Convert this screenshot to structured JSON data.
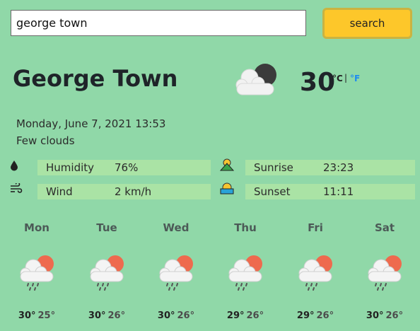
{
  "search": {
    "value": "george town",
    "button_label": "search"
  },
  "current": {
    "city": "George Town",
    "temperature": "30",
    "unit_c": "°C",
    "unit_sep": "|",
    "unit_f": "°F",
    "datetime": "Monday, June 7, 2021 13:53",
    "description": "Few clouds",
    "icon": "cloud-moon-icon"
  },
  "stats": {
    "humidity_label": "Humidity",
    "humidity_value": "76%",
    "wind_label": "Wind",
    "wind_value": "2 km/h",
    "sunrise_label": "Sunrise",
    "sunrise_value": "23:23",
    "sunset_label": "Sunset",
    "sunset_value": "11:11"
  },
  "forecast": [
    {
      "day": "Mon",
      "hi": "30°",
      "lo": "25°",
      "icon": "rain-cloud-sun-icon"
    },
    {
      "day": "Tue",
      "hi": "30°",
      "lo": "26°",
      "icon": "rain-cloud-sun-icon"
    },
    {
      "day": "Wed",
      "hi": "30°",
      "lo": "26°",
      "icon": "rain-cloud-sun-icon"
    },
    {
      "day": "Thu",
      "hi": "29°",
      "lo": "26°",
      "icon": "rain-cloud-sun-icon"
    },
    {
      "day": "Fri",
      "hi": "29°",
      "lo": "26°",
      "icon": "rain-cloud-sun-icon"
    },
    {
      "day": "Sat",
      "hi": "30°",
      "lo": "26°",
      "icon": "rain-cloud-sun-icon"
    }
  ],
  "colors": {
    "background": "#90d8a8",
    "button": "#fdc72a",
    "stat_bar": "#aae3a5",
    "fahrenheit_link": "#1d8cf0",
    "sun": "#ee6a4e"
  }
}
